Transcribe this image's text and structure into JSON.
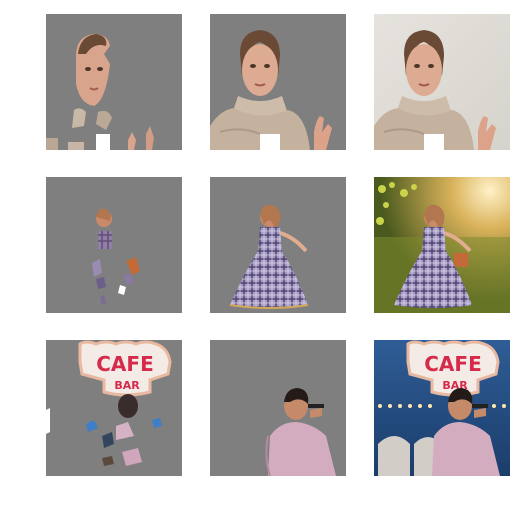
{
  "figure": {
    "rows": [
      {
        "subject": "woman in beige sweater holding cup",
        "panels": [
          "coarse-mask",
          "refined-mask",
          "original"
        ]
      },
      {
        "subject": "girl in plaid dress in sunny field",
        "panels": [
          "coarse-mask",
          "refined-mask",
          "original"
        ]
      },
      {
        "subject": "man singing in front of cafe bar sign",
        "panels": [
          "coarse-mask",
          "refined-mask",
          "original"
        ]
      }
    ],
    "sign": {
      "top_text": "CAFE",
      "bottom_text": "BAR"
    },
    "colors": {
      "mask_gray": "#7f7f7f",
      "background": "#ffffff"
    }
  }
}
